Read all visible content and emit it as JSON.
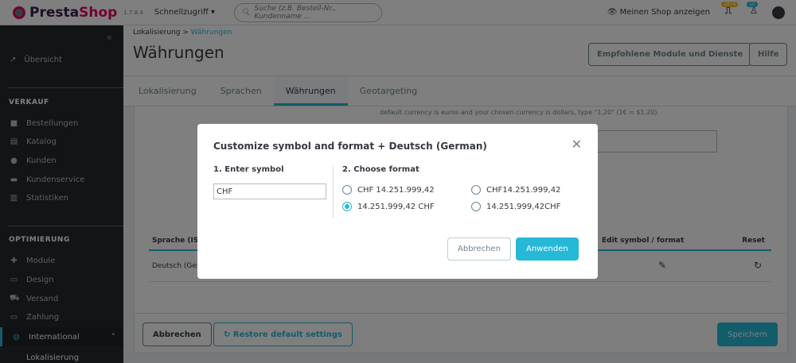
{
  "header": {
    "brand_a": "Presta",
    "brand_b": "Shop",
    "version": "1.7.8.4",
    "quick_access": "Schnellzugriff",
    "search_placeholder": "Suche (z.B. Bestell-Nr., Kundenname ...",
    "view_shop": "Meinen Shop anzeigen",
    "orders_badge": "1874",
    "customers_badge": "10"
  },
  "sidebar": {
    "overview": "Übersicht",
    "sections": [
      {
        "title": "VERKAUF",
        "items": [
          "Bestellungen",
          "Katalog",
          "Kunden",
          "Kundenservice",
          "Statistiken"
        ]
      },
      {
        "title": "OPTIMIERUNG",
        "items": [
          "Module",
          "Design",
          "Versand",
          "Zahlung"
        ]
      }
    ],
    "international": "International",
    "sub_item": "Lokalisierung"
  },
  "page": {
    "breadcrumb_parent": "Lokalisierung",
    "breadcrumb_sep": ">",
    "breadcrumb_current": "Währungen",
    "title": "Währungen",
    "btn_modules": "Empfohlene Module und Dienste",
    "btn_help": "Hilfe",
    "tabs": [
      "Lokalisierung",
      "Sprachen",
      "Währungen",
      "Geotargeting"
    ],
    "help_text": "default currency is euros and your chosen currency is dollars, type \"1,20\" (1€ = $1.20).",
    "table": {
      "headers": [
        "Sprache (ISO",
        "Edit symbol / format",
        "Reset"
      ],
      "row_lang": "Deutsch (Ger"
    },
    "footer": {
      "cancel": "Abbrechen",
      "restore": "Restore default settings",
      "save": "Speichern"
    }
  },
  "modal": {
    "title": "Customize symbol and format + Deutsch (German)",
    "step1": "1. Enter symbol",
    "symbol_value": "CHF",
    "step2": "2. Choose format",
    "formats": [
      "CHF 14.251.999,42",
      "CHF14.251.999,42",
      "14.251.999,42 CHF",
      "14.251.999,42CHF"
    ],
    "selected_format": "14.251.999,42 CHF",
    "cancel": "Abbrechen",
    "apply": "Anwenden"
  },
  "colors": {
    "accent": "#25b9d7",
    "brand": "#df0067",
    "sidebar": "#25282b"
  }
}
